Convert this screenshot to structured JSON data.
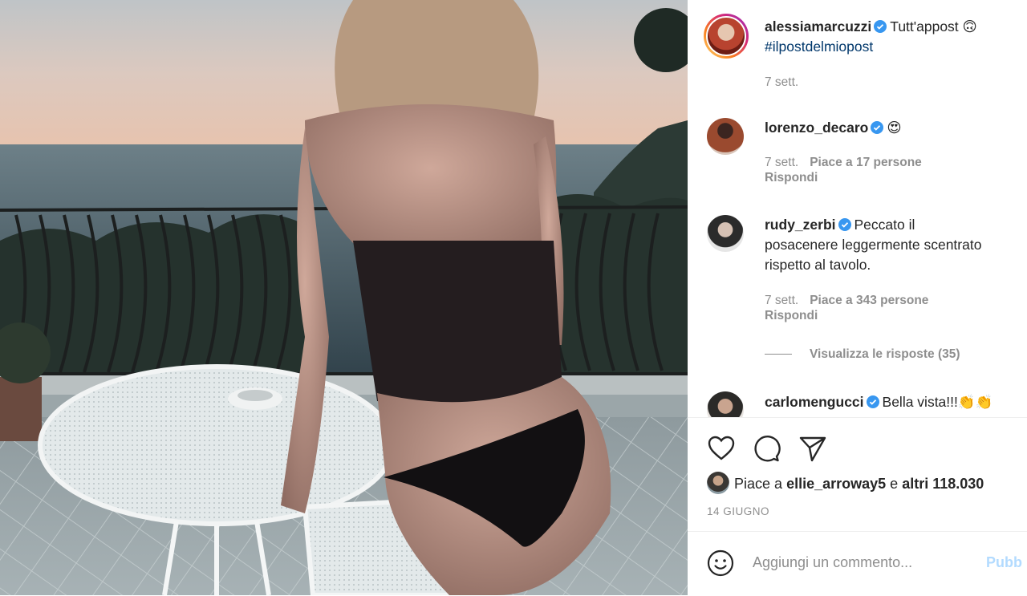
{
  "post": {
    "author": "alessiamarcuzzi",
    "caption": "Tutt'appost 🙃",
    "hashtag": "#ilpostdelmiopost",
    "time": "7 sett."
  },
  "comments": [
    {
      "user": "lorenzo_decaro",
      "text": "😍",
      "time": "7 sett.",
      "likes": "Piace a 17 persone",
      "reply": "Rispondi"
    },
    {
      "user": "rudy_zerbi",
      "text_lines": [
        "Peccato il",
        "posacenere leggermente scentrato",
        "rispetto al tavolo."
      ],
      "time": "7 sett.",
      "likes": "Piace a 343 persone",
      "reply": "Rispondi",
      "view_replies": "Visualizza le risposte (35)"
    },
    {
      "user": "carlomengucci",
      "text": "Bella vista!!!👏👏"
    }
  ],
  "likes": {
    "prefix": "Piace a",
    "user": "ellie_arroway5",
    "middle": "e",
    "others": "altri 118.030"
  },
  "date": "14 GIUGNO",
  "comment_box": {
    "placeholder": "Aggiungi un commento...",
    "publish": "Pubb"
  },
  "colors": {
    "verified": "#3897f0",
    "text": "#262626",
    "muted": "#8e8e8e",
    "publish": "#b3dbff"
  },
  "icons": [
    "heart-icon",
    "comment-icon",
    "share-icon",
    "emoji-icon",
    "verified-badge-icon"
  ]
}
